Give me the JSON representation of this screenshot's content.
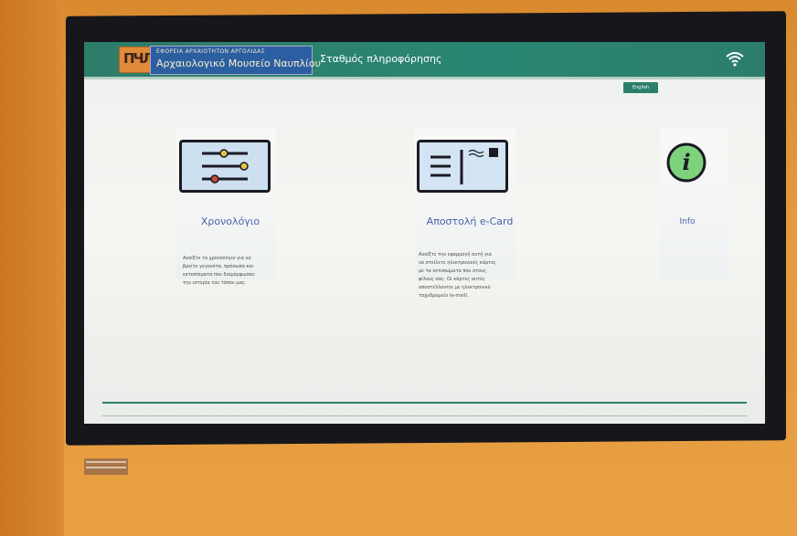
{
  "header": {
    "org_top": "ΕΦΟΡΕΙΑ ΑΡΧΑΙΟΤΗΤΩΝ ΑΡΓΟΛΙΔΑΣ",
    "org_main": "Αρχαιολογικό Μουσείο Ναυπλίου",
    "station": "Σταθμός πληροφόρησης"
  },
  "language_button": "English",
  "tiles": [
    {
      "title": "Χρονολόγιο",
      "description": [
        "Ανοίξτε το χρονολόγιο για να",
        "βρείτε γεγονότα, πρόσωπα και",
        "εκτοπίσματα που διαμόρφωσαν",
        "την ιστορία του τόπου μας."
      ]
    },
    {
      "title": "Αποστολή e-Card",
      "description": [
        "Ανοίξτε την εφαρμογή αυτή για",
        "να στείλετε ηλεκτρονικές κάρτες",
        "με τα εκτυπώματα που στους",
        "φίλους σας. Οι κάρτες αυτές",
        "αποστέλλονται με ηλεκτρονικό",
        "ταχυδρομείο (e-mail)."
      ]
    },
    {
      "title": "Info",
      "description": []
    }
  ],
  "colors": {
    "header": "#2b7f6c",
    "org_bg": "#2c5fa1",
    "title": "#4762a9",
    "info_icon": "#7cd37c"
  }
}
